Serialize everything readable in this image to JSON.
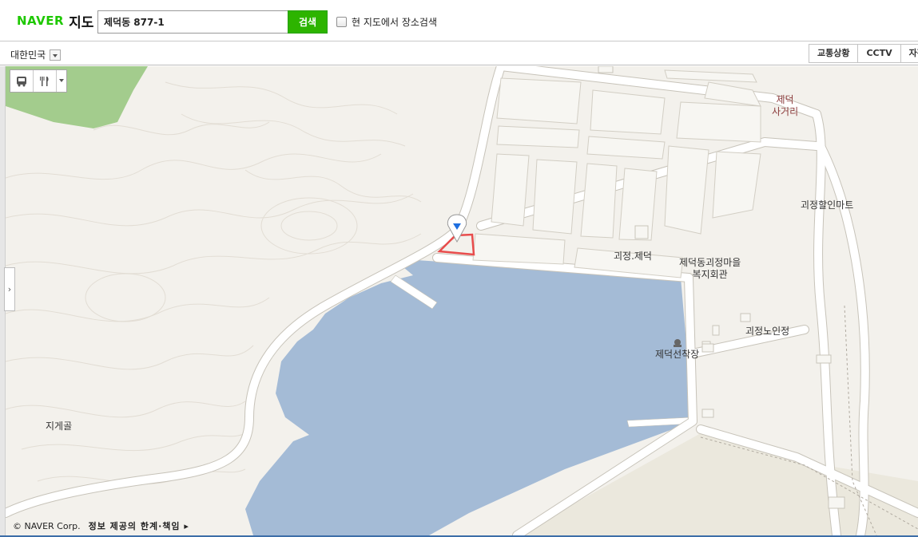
{
  "logo": {
    "brand": "NAVER",
    "service": "지도"
  },
  "search": {
    "value": "제덕동 877-1",
    "button_label": "검색",
    "local_search_label": "현 지도에서 장소검색"
  },
  "region": {
    "selected": "대한민국"
  },
  "layer_tabs": [
    "교통상황",
    "CCTV",
    "자전"
  ],
  "map_labels": {
    "jedeok_intersection": [
      "제덕",
      "사거리"
    ],
    "mart": "괴정할인마트",
    "gwaejeong_jedeok": "괴정.제덕",
    "welfare_center": [
      "제덕동괴정마을",
      "복지회관"
    ],
    "pier": "제덕선착장",
    "senior_center": "괴정노인정",
    "jigegol": "지게골"
  },
  "copyright": {
    "company": "© NAVER Corp.",
    "disclaimer": "정보 제공의 한계·책임 ▸"
  },
  "colors": {
    "brand": "#1ec800",
    "search_button": "#2db400",
    "water": "#a4bbd6",
    "park": "#a3cc8d",
    "land": "#f3f1ec",
    "road": "#ffffff",
    "parcel_outline": "#e84c4c",
    "marker": "#1f6fe0"
  }
}
